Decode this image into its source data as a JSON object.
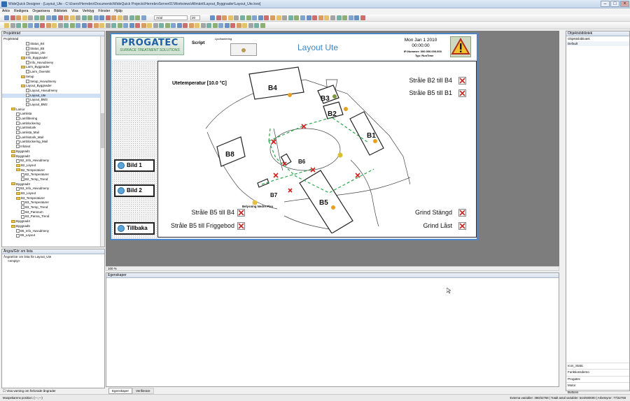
{
  "window": {
    "title": "WideQuick Designer - [Layout_Ute - C:\\Users\\Herrebro\\Documents\\WideQuick Projects\\HerrebroServer01\\Workviews\\Allmänt\\Layout_Byggnader\\Layout_Ute.kvw]"
  },
  "menu": [
    "Arkiv",
    "Redigera",
    "Organisera",
    "Bibliotek",
    "Visa",
    "Verktyg",
    "Fönster",
    "Hjälp"
  ],
  "toolbar": {
    "font": "Arial",
    "size": "20"
  },
  "project_panel": {
    "title": "Projektträd",
    "root": "Projektträd",
    "items": [
      {
        "label": "Status_B4",
        "depth": 4,
        "type": "page"
      },
      {
        "label": "Status_B5",
        "depth": 4,
        "type": "page"
      },
      {
        "label": "Status_Ute",
        "depth": 4,
        "type": "page"
      },
      {
        "label": "Info_Byggnader",
        "depth": 3,
        "type": "folder"
      },
      {
        "label": "Info_Huvudmeny",
        "depth": 4,
        "type": "page"
      },
      {
        "label": "Larm_Byggnader",
        "depth": 3,
        "type": "folder"
      },
      {
        "label": "Larm_Översikt",
        "depth": 4,
        "type": "page"
      },
      {
        "label": "Setup",
        "depth": 3,
        "type": "folder"
      },
      {
        "label": "Setup_Huvudmeny",
        "depth": 4,
        "type": "page"
      },
      {
        "label": "Layout_Byggnader",
        "depth": 3,
        "type": "folder"
      },
      {
        "label": "Layout_Huvudmeny",
        "depth": 4,
        "type": "page"
      },
      {
        "label": "Layout_Ute",
        "depth": 4,
        "type": "page",
        "selected": true
      },
      {
        "label": "Layout_BM3",
        "depth": 4,
        "type": "page"
      },
      {
        "label": "Layout_BM2",
        "depth": 4,
        "type": "page"
      },
      {
        "label": "Lamor",
        "depth": 1,
        "type": "folder"
      },
      {
        "label": "Lamlista",
        "depth": 2,
        "type": "page"
      },
      {
        "label": "Lamfiltrering",
        "depth": 2,
        "type": "page"
      },
      {
        "label": "Lamblockering",
        "depth": 2,
        "type": "page"
      },
      {
        "label": "Lamhistorik",
        "depth": 2,
        "type": "page"
      },
      {
        "label": "Lamlista_Mail",
        "depth": 2,
        "type": "page"
      },
      {
        "label": "Lamhistorik_Mail",
        "depth": 2,
        "type": "page"
      },
      {
        "label": "Lamblockering_Mail",
        "depth": 2,
        "type": "page"
      },
      {
        "label": "Infotext",
        "depth": 2,
        "type": "page"
      },
      {
        "label": "Byggnad1",
        "depth": 1,
        "type": "folder"
      },
      {
        "label": "Byggnad2",
        "depth": 1,
        "type": "folder"
      },
      {
        "label": "B2_Info_Huvudmeny",
        "depth": 2,
        "type": "page"
      },
      {
        "label": "B2_Layout",
        "depth": 2,
        "type": "folder"
      },
      {
        "label": "B2_Temperaturer",
        "depth": 2,
        "type": "folder"
      },
      {
        "label": "B2_Temperaturer",
        "depth": 3,
        "type": "page"
      },
      {
        "label": "B2_Temp_Trend",
        "depth": 3,
        "type": "page"
      },
      {
        "label": "Byggnad3",
        "depth": 1,
        "type": "folder"
      },
      {
        "label": "B3_Info_Huvudmeny",
        "depth": 2,
        "type": "page"
      },
      {
        "label": "B3_Layout",
        "depth": 2,
        "type": "folder"
      },
      {
        "label": "B3_Temperaturer",
        "depth": 2,
        "type": "folder"
      },
      {
        "label": "B3_Temperaturer",
        "depth": 3,
        "type": "page"
      },
      {
        "label": "B3_Temp_Trend",
        "depth": 3,
        "type": "page"
      },
      {
        "label": "B3_Pannrum",
        "depth": 3,
        "type": "page"
      },
      {
        "label": "B3_Panna_Trend",
        "depth": 3,
        "type": "page"
      },
      {
        "label": "Byggnad4",
        "depth": 1,
        "type": "folder"
      },
      {
        "label": "Byggnad5",
        "depth": 1,
        "type": "folder"
      },
      {
        "label": "B5_Info_Huvudmeny",
        "depth": 2,
        "type": "page"
      },
      {
        "label": "B5_Layout",
        "depth": 2,
        "type": "page"
      }
    ]
  },
  "undo_panel": {
    "title": "Ångra/Gör om lista",
    "subtitle": "Ångra/Gör om lista för Layout_Ute",
    "entry": "<empty>",
    "checkbox": "Visa varning om förlorade ångrader",
    "mouse_pos": "Muspekarens position: (---,---)"
  },
  "hmi": {
    "logo": "PROGATEC",
    "logo_sub": "SURFACE TREATMENT SOLUTIONS",
    "script": "Script",
    "ljud_label": "Ljudhantering",
    "title": "Layout Ute",
    "date": "Mon Jan 1 2010",
    "time": "00:00:00",
    "ip_label": "IP-Nummer:",
    "ip_value": "000.000.000.000",
    "typ_label": "Typ:",
    "typ_value": "RunTime",
    "nav": [
      "Bild 1",
      "Bild 2",
      "Tillbaka"
    ],
    "temp": "Utetemperatur  [10.0 °C]",
    "alarms_top": [
      "Stråle B2 till B4",
      "Stråle B5 till B1"
    ],
    "alarms_bottom_left": [
      "Stråle B5 till B4",
      "Stråle B5 till Friggebod"
    ],
    "alarms_bottom_right": [
      "Grind Stängd",
      "Grind Låst"
    ],
    "buildings": [
      "B4",
      "B3",
      "B2",
      "B1",
      "B8",
      "B6",
      "B5",
      "B7"
    ],
    "map_note": "Belysning Nedre Plan"
  },
  "zoom": "100 %",
  "properties_panel": {
    "title": "Egenskaper",
    "tabs": [
      "Egenskaper",
      "Verifierare"
    ]
  },
  "object_panel": {
    "title": "Objektsbibliotek",
    "root": "Objektsbibliotek",
    "default": "Default",
    "items": [
      "Icon_Static",
      "Funktionsdemo",
      "Progatec",
      "Motor",
      "Buttons"
    ]
  },
  "status": {
    "left": "Muspekarens position: (---,---)",
    "right": "Externa variabler: 380/32768 | Totalt antal variabler: 544/600000 | Arbetsyrer: 77/32768"
  }
}
